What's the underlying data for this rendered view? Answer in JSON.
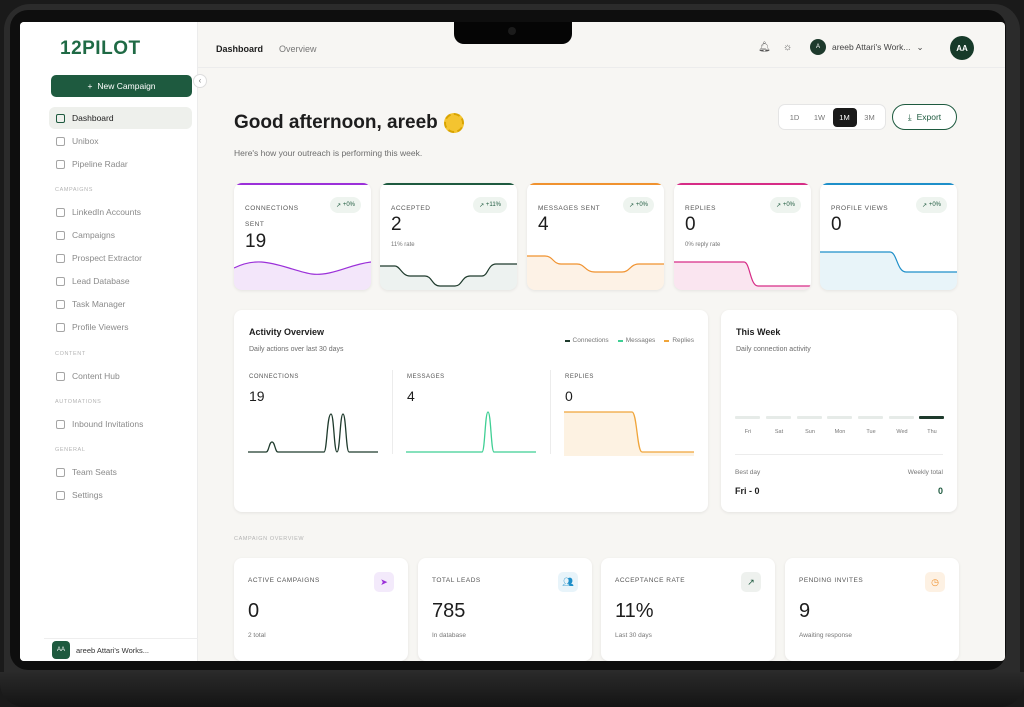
{
  "app": {
    "logo": "12PILOT",
    "tabs": [
      "Dashboard",
      "Overview"
    ],
    "workspace_name": "areeb Attari's Work...",
    "workspace_initial": "A",
    "user_initials": "AA"
  },
  "sidebar": {
    "new_campaign_label": "New Campaign",
    "items_main": [
      {
        "label": "Dashboard",
        "icon": "grid-icon",
        "active": true
      },
      {
        "label": "Unibox",
        "icon": "inbox-icon"
      },
      {
        "label": "Pipeline Radar",
        "icon": "radar-icon"
      }
    ],
    "sections": {
      "campaigns": "CAMPAIGNS",
      "content": "CONTENT",
      "automations": "AUTOMATIONS",
      "general": "GENERAL"
    },
    "items_campaigns": [
      {
        "label": "LinkedIn Accounts",
        "icon": "users-icon"
      },
      {
        "label": "Campaigns",
        "icon": "send-icon"
      },
      {
        "label": "Prospect Extractor",
        "icon": "search-icon"
      },
      {
        "label": "Lead Database",
        "icon": "database-icon"
      },
      {
        "label": "Task Manager",
        "icon": "checklist-icon"
      },
      {
        "label": "Profile Viewers",
        "icon": "eye-icon"
      }
    ],
    "items_content": [
      {
        "label": "Content Hub",
        "icon": "document-icon"
      }
    ],
    "items_automations": [
      {
        "label": "Inbound Invitations",
        "icon": "user-plus-icon"
      }
    ],
    "items_general": [
      {
        "label": "Team Seats",
        "icon": "team-icon"
      },
      {
        "label": "Settings",
        "icon": "gear-icon"
      }
    ],
    "footer_workspace": "areeb Attari's Works...",
    "footer_initials": "AA"
  },
  "header": {
    "greeting": "Good afternoon, areeb",
    "subtitle": "Here's how your outreach is performing this week.",
    "ranges": [
      "1D",
      "1W",
      "1M",
      "3M"
    ],
    "selected_range": "1M",
    "export_label": "Export"
  },
  "stats": [
    {
      "label": "CONNECTIONS SENT",
      "value": "19",
      "delta": "+0%",
      "sub": "",
      "color": "#9b30d9"
    },
    {
      "label": "ACCEPTED",
      "value": "2",
      "delta": "+11%",
      "sub": "11% rate",
      "color": "#1e5a3f"
    },
    {
      "label": "MESSAGES SENT",
      "value": "4",
      "delta": "+0%",
      "sub": "",
      "color": "#f0922f"
    },
    {
      "label": "REPLIES",
      "value": "0",
      "delta": "+0%",
      "sub": "0% reply rate",
      "color": "#d62c86"
    },
    {
      "label": "PROFILE VIEWS",
      "value": "0",
      "delta": "+0%",
      "sub": "",
      "color": "#1e8fc9"
    }
  ],
  "activity": {
    "title": "Activity Overview",
    "subtitle": "Daily actions over last 30 days",
    "legend": [
      "Connections",
      "Messages",
      "Replies"
    ],
    "legend_colors": [
      "#1e3a2c",
      "#3fcf94",
      "#f0a53a"
    ],
    "columns": [
      {
        "label": "CONNECTIONS",
        "value": "19"
      },
      {
        "label": "MESSAGES",
        "value": "4"
      },
      {
        "label": "REPLIES",
        "value": "0"
      }
    ]
  },
  "this_week": {
    "title": "This Week",
    "subtitle": "Daily connection activity",
    "days": [
      "Fri",
      "Sat",
      "Sun",
      "Mon",
      "Tue",
      "Wed",
      "Thu"
    ],
    "best_day_label": "Best day",
    "best_day_value": "Fri - 0",
    "weekly_total_label": "Weekly total",
    "weekly_total_value": "0"
  },
  "campaign_overview": {
    "label": "CAMPAIGN OVERVIEW",
    "cards": [
      {
        "label": "ACTIVE CAMPAIGNS",
        "value": "0",
        "sub": "2 total",
        "icon": "send-icon",
        "icon_color": "#9b30d9",
        "icon_bg": "#f3eafb"
      },
      {
        "label": "TOTAL LEADS",
        "value": "785",
        "sub": "In database",
        "icon": "users-icon",
        "icon_color": "#1e8fc9",
        "icon_bg": "#e8f4fa"
      },
      {
        "label": "ACCEPTANCE RATE",
        "value": "11%",
        "sub": "Last 30 days",
        "icon": "trend-up-icon",
        "icon_color": "#1e5a3f",
        "icon_bg": "#eef1ee"
      },
      {
        "label": "PENDING INVITES",
        "value": "9",
        "sub": "Awaiting response",
        "icon": "clock-icon",
        "icon_color": "#f0922f",
        "icon_bg": "#fdf1e3"
      }
    ]
  }
}
